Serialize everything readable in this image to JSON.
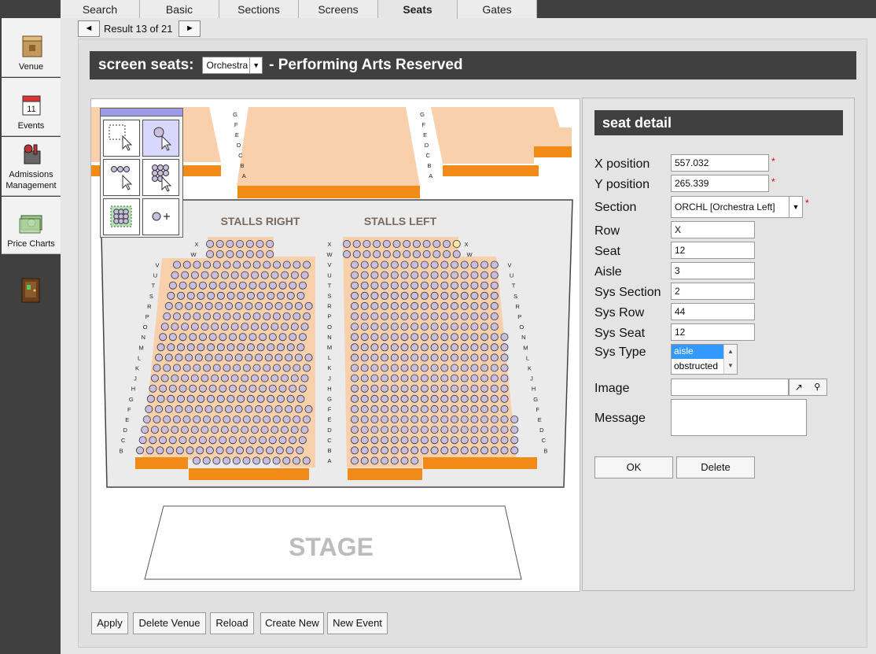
{
  "nav": [
    {
      "label_1": "Venue",
      "label_2": "",
      "icon": "venue-box-icon"
    },
    {
      "label_1": "Events",
      "label_2": "",
      "icon": "calendar-icon"
    },
    {
      "label_1": "Admissions",
      "label_2": "Management",
      "icon": "admissions-icon"
    },
    {
      "label_1": "Price Charts",
      "label_2": "",
      "icon": "price-charts-icon"
    },
    {
      "icon": "exit-door-icon"
    }
  ],
  "tabs": [
    "Search",
    "Basic",
    "Sections",
    "Screens",
    "Seats",
    "Gates"
  ],
  "active_tab": "Seats",
  "pager": {
    "prev": "◄",
    "text": "Result 13 of 21",
    "next": "►"
  },
  "title": {
    "prefix": "screen seats:",
    "screen_value": "Orchestra",
    "suffix": "- Performing Arts Reserved"
  },
  "seatmap": {
    "stalls_right": "STALLS RIGHT",
    "stalls_left": "STALLS LEFT",
    "stage": "STAGE",
    "upper_rows_left": [
      "G",
      "F",
      "E",
      "D",
      "C",
      "B",
      "A"
    ],
    "upper_rows_right": [
      "G",
      "F",
      "E",
      "D",
      "C",
      "B",
      "A"
    ],
    "rows": [
      "V",
      "U",
      "T",
      "S",
      "R",
      "P",
      "O",
      "N",
      "M",
      "L",
      "K",
      "J",
      "H",
      "G",
      "F",
      "E",
      "D",
      "C",
      "B"
    ],
    "center_rows": [
      "X",
      "W",
      "V",
      "U",
      "T",
      "S",
      "R",
      "P",
      "O",
      "N",
      "M",
      "L",
      "K",
      "J",
      "H",
      "G",
      "F",
      "E",
      "D",
      "C",
      "B",
      "A"
    ],
    "colors": {
      "seat_fill": "#c8bedf",
      "seat_stroke": "#333333",
      "section_fill": "#f8d0ac",
      "riser": "#f28a18",
      "selected_seat": "#f5e6a0"
    }
  },
  "detail": {
    "title": "seat detail",
    "x_label": "X position",
    "x_value": "557.032",
    "y_label": "Y position",
    "y_value": "265.339",
    "section_label": "Section",
    "section_value": "ORCHL [Orchestra Left]",
    "row_label": "Row",
    "row_value": "X",
    "seat_label": "Seat",
    "seat_value": "12",
    "aisle_label": "Aisle",
    "aisle_value": "3",
    "sys_section_label": "Sys Section",
    "sys_section_value": "2",
    "sys_row_label": "Sys Row",
    "sys_row_value": "44",
    "sys_seat_label": "Sys Seat",
    "sys_seat_value": "12",
    "sys_type_label": "Sys Type",
    "sys_type_options": [
      "aisle",
      "obstructed"
    ],
    "sys_type_selected": "aisle",
    "image_label": "Image",
    "image_value": "",
    "message_label": "Message",
    "message_value": "",
    "required_mark": "*",
    "ok": "OK",
    "delete": "Delete"
  },
  "bottom_buttons": [
    "Apply",
    "Delete Venue",
    "Reload",
    "Create New",
    "New Event"
  ]
}
